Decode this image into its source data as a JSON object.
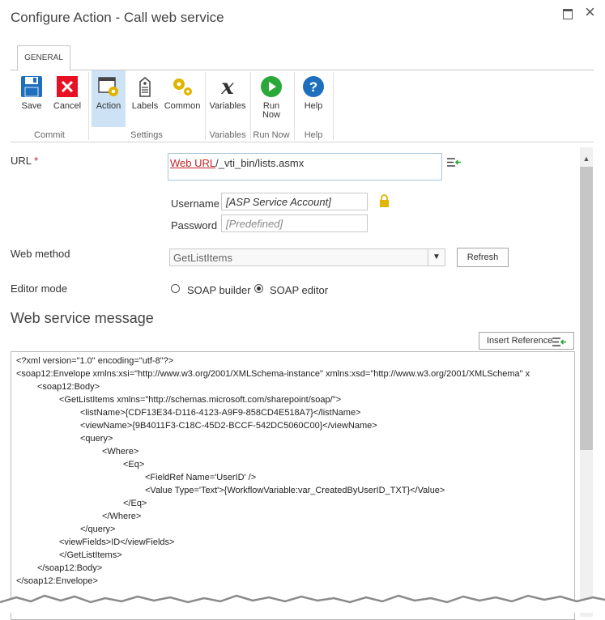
{
  "window": {
    "title": "Configure Action - Call web service"
  },
  "ribbon": {
    "tab": "GENERAL",
    "buttons": {
      "save": "Save",
      "cancel": "Cancel",
      "action": "Action",
      "labels": "Labels",
      "common": "Common",
      "variables": "Variables",
      "run_now": "Run Now",
      "help": "Help"
    },
    "groups": {
      "commit": "Commit",
      "settings": "Settings",
      "variables": "Variables",
      "run_now": "Run Now",
      "help": "Help"
    }
  },
  "form": {
    "url_label": "URL",
    "url_required_mark": "*",
    "url_token": "Web URL",
    "url_rest": "/_vti_bin/lists.asmx",
    "username_label": "Username",
    "username_value": "[ASP Service Account]",
    "password_label": "Password",
    "password_value": "[Predefined]",
    "web_method_label": "Web method",
    "web_method_value": "GetListItems",
    "refresh_label": "Refresh",
    "editor_mode_label": "Editor mode",
    "editor_modes": [
      "SOAP builder",
      "SOAP editor"
    ],
    "editor_mode_selected": "SOAP editor"
  },
  "message": {
    "heading": "Web service message",
    "insert_reference_label": "Insert Reference",
    "lines": [
      "<?xml version=\"1.0\" encoding=\"utf-8\"?>",
      "<soap12:Envelope xmlns:xsi=\"http://www.w3.org/2001/XMLSchema-instance\" xmlns:xsd=\"http://www.w3.org/2001/XMLSchema\" x",
      "<soap12:Body>",
      "<GetListItems xmlns=\"http://schemas.microsoft.com/sharepoint/soap/\">",
      "<listName>{CDF13E34-D116-4123-A9F9-858CD4E518A7}</listName>",
      "<viewName>{9B4011F3-C18C-45D2-BCCF-542DC5060C00}</viewName>",
      "<query>",
      "<Where>",
      "<Eq>",
      "<FieldRef Name='UserID' />",
      "<Value Type='Text'>{WorkflowVariable:var_CreatedByUserID_TXT}</Value>",
      "</Eq>",
      "</Where>",
      "</query>",
      "<viewFields>ID</viewFields>",
      "</GetListItems>",
      "</soap12:Body>",
      "</soap12:Envelope>"
    ]
  },
  "colors": {
    "accent_blue": "#1f6fbf",
    "required_red": "#c0262d",
    "selected_tab_bg": "#cde3f5",
    "run_green": "#2aa83a",
    "lock_gold": "#e1b400"
  },
  "icons": [
    "save-icon",
    "cancel-icon",
    "action-icon",
    "labels-icon",
    "common-icon",
    "variables-icon",
    "run-now-icon",
    "help-icon",
    "insert-reference-icon",
    "lock-icon"
  ]
}
